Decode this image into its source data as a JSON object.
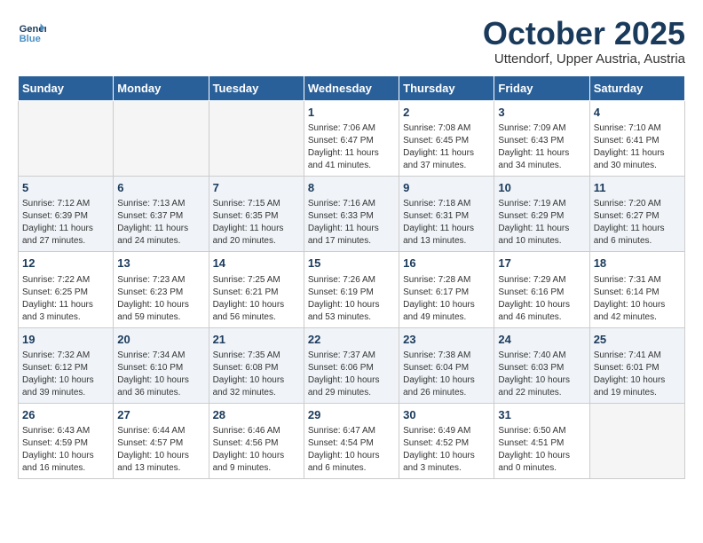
{
  "logo": {
    "line1": "General",
    "line2": "Blue"
  },
  "title": "October 2025",
  "subtitle": "Uttendorf, Upper Austria, Austria",
  "weekdays": [
    "Sunday",
    "Monday",
    "Tuesday",
    "Wednesday",
    "Thursday",
    "Friday",
    "Saturday"
  ],
  "weeks": [
    [
      {
        "day": "",
        "info": ""
      },
      {
        "day": "",
        "info": ""
      },
      {
        "day": "",
        "info": ""
      },
      {
        "day": "1",
        "info": "Sunrise: 7:06 AM\nSunset: 6:47 PM\nDaylight: 11 hours\nand 41 minutes."
      },
      {
        "day": "2",
        "info": "Sunrise: 7:08 AM\nSunset: 6:45 PM\nDaylight: 11 hours\nand 37 minutes."
      },
      {
        "day": "3",
        "info": "Sunrise: 7:09 AM\nSunset: 6:43 PM\nDaylight: 11 hours\nand 34 minutes."
      },
      {
        "day": "4",
        "info": "Sunrise: 7:10 AM\nSunset: 6:41 PM\nDaylight: 11 hours\nand 30 minutes."
      }
    ],
    [
      {
        "day": "5",
        "info": "Sunrise: 7:12 AM\nSunset: 6:39 PM\nDaylight: 11 hours\nand 27 minutes."
      },
      {
        "day": "6",
        "info": "Sunrise: 7:13 AM\nSunset: 6:37 PM\nDaylight: 11 hours\nand 24 minutes."
      },
      {
        "day": "7",
        "info": "Sunrise: 7:15 AM\nSunset: 6:35 PM\nDaylight: 11 hours\nand 20 minutes."
      },
      {
        "day": "8",
        "info": "Sunrise: 7:16 AM\nSunset: 6:33 PM\nDaylight: 11 hours\nand 17 minutes."
      },
      {
        "day": "9",
        "info": "Sunrise: 7:18 AM\nSunset: 6:31 PM\nDaylight: 11 hours\nand 13 minutes."
      },
      {
        "day": "10",
        "info": "Sunrise: 7:19 AM\nSunset: 6:29 PM\nDaylight: 11 hours\nand 10 minutes."
      },
      {
        "day": "11",
        "info": "Sunrise: 7:20 AM\nSunset: 6:27 PM\nDaylight: 11 hours\nand 6 minutes."
      }
    ],
    [
      {
        "day": "12",
        "info": "Sunrise: 7:22 AM\nSunset: 6:25 PM\nDaylight: 11 hours\nand 3 minutes."
      },
      {
        "day": "13",
        "info": "Sunrise: 7:23 AM\nSunset: 6:23 PM\nDaylight: 10 hours\nand 59 minutes."
      },
      {
        "day": "14",
        "info": "Sunrise: 7:25 AM\nSunset: 6:21 PM\nDaylight: 10 hours\nand 56 minutes."
      },
      {
        "day": "15",
        "info": "Sunrise: 7:26 AM\nSunset: 6:19 PM\nDaylight: 10 hours\nand 53 minutes."
      },
      {
        "day": "16",
        "info": "Sunrise: 7:28 AM\nSunset: 6:17 PM\nDaylight: 10 hours\nand 49 minutes."
      },
      {
        "day": "17",
        "info": "Sunrise: 7:29 AM\nSunset: 6:16 PM\nDaylight: 10 hours\nand 46 minutes."
      },
      {
        "day": "18",
        "info": "Sunrise: 7:31 AM\nSunset: 6:14 PM\nDaylight: 10 hours\nand 42 minutes."
      }
    ],
    [
      {
        "day": "19",
        "info": "Sunrise: 7:32 AM\nSunset: 6:12 PM\nDaylight: 10 hours\nand 39 minutes."
      },
      {
        "day": "20",
        "info": "Sunrise: 7:34 AM\nSunset: 6:10 PM\nDaylight: 10 hours\nand 36 minutes."
      },
      {
        "day": "21",
        "info": "Sunrise: 7:35 AM\nSunset: 6:08 PM\nDaylight: 10 hours\nand 32 minutes."
      },
      {
        "day": "22",
        "info": "Sunrise: 7:37 AM\nSunset: 6:06 PM\nDaylight: 10 hours\nand 29 minutes."
      },
      {
        "day": "23",
        "info": "Sunrise: 7:38 AM\nSunset: 6:04 PM\nDaylight: 10 hours\nand 26 minutes."
      },
      {
        "day": "24",
        "info": "Sunrise: 7:40 AM\nSunset: 6:03 PM\nDaylight: 10 hours\nand 22 minutes."
      },
      {
        "day": "25",
        "info": "Sunrise: 7:41 AM\nSunset: 6:01 PM\nDaylight: 10 hours\nand 19 minutes."
      }
    ],
    [
      {
        "day": "26",
        "info": "Sunrise: 6:43 AM\nSunset: 4:59 PM\nDaylight: 10 hours\nand 16 minutes."
      },
      {
        "day": "27",
        "info": "Sunrise: 6:44 AM\nSunset: 4:57 PM\nDaylight: 10 hours\nand 13 minutes."
      },
      {
        "day": "28",
        "info": "Sunrise: 6:46 AM\nSunset: 4:56 PM\nDaylight: 10 hours\nand 9 minutes."
      },
      {
        "day": "29",
        "info": "Sunrise: 6:47 AM\nSunset: 4:54 PM\nDaylight: 10 hours\nand 6 minutes."
      },
      {
        "day": "30",
        "info": "Sunrise: 6:49 AM\nSunset: 4:52 PM\nDaylight: 10 hours\nand 3 minutes."
      },
      {
        "day": "31",
        "info": "Sunrise: 6:50 AM\nSunset: 4:51 PM\nDaylight: 10 hours\nand 0 minutes."
      },
      {
        "day": "",
        "info": ""
      }
    ]
  ]
}
